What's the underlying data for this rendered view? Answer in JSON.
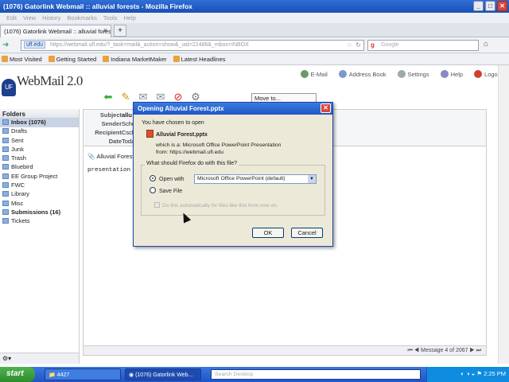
{
  "window": {
    "title": "(1076) Gatorlink Webmail :: alluvial forests - Mozilla Firefox"
  },
  "menubar": [
    "Edit",
    "View",
    "History",
    "Bookmarks",
    "Tools",
    "Help"
  ],
  "tab": {
    "label": "(1076) Gatorlink Webmail :: alluvial forests"
  },
  "url": {
    "domain": "ufl.edu",
    "path": "https://webmail.ufl.edu/?_task=mail&_action=show&_uid=22486&_mbox=INBOX"
  },
  "search": {
    "placeholder": "Google"
  },
  "bookmarks": [
    "Most Visited",
    "Getting Started",
    "Indiana MarketMaker",
    "Latest Headlines"
  ],
  "webmail": {
    "logo": "WebMail 2.0",
    "logo_badge": "UF",
    "links": [
      "E-Mail",
      "Address Book",
      "Settings",
      "Help",
      "Logout"
    ],
    "moveto": "Move to..."
  },
  "folders": {
    "title": "Folders",
    "items": [
      {
        "label": "Inbox (1076)",
        "active": true
      },
      {
        "label": "Drafts"
      },
      {
        "label": "Sent"
      },
      {
        "label": "Junk"
      },
      {
        "label": "Trash"
      },
      {
        "label": "Bluebird"
      },
      {
        "label": "EE Group Project"
      },
      {
        "label": "FWC"
      },
      {
        "label": "Library"
      },
      {
        "label": "Misc"
      },
      {
        "label": "Submissions (16)",
        "bold": true
      },
      {
        "label": "Tickets"
      }
    ]
  },
  "message": {
    "labels": {
      "subject": "Subject",
      "sender": "Sender",
      "recipient": "Recipient",
      "date": "Date"
    },
    "values": {
      "subject": "allu",
      "sender": "Scho",
      "recipient": "Csch",
      "date": "Toda"
    },
    "attachment": "Alluvial Forest",
    "body": "presentation",
    "footer": "Message 4 of 2067"
  },
  "dialog": {
    "title": "Opening Alluvial Forest.pptx",
    "intro": "You have chosen to open",
    "filename": "Alluvial Forest.pptx",
    "which_is": "which is a:  Microsoft Office PowerPoint Presentation",
    "from": "from:  https://webmail.ufl.edu",
    "question": "What should Firefox do with this file?",
    "open_with_label": "Open with",
    "open_with_value": "Microsoft Office PowerPoint (default)",
    "save_label": "Save File",
    "auto_label": "Do this automatically for files like this from now on.",
    "ok": "OK",
    "cancel": "Cancel"
  },
  "taskbar": {
    "start": "start",
    "tasks": [
      "4427",
      "(1076) Gatorlink Web..."
    ],
    "search_placeholder": "Search Desktop",
    "time": "2:25 PM"
  },
  "colors": {
    "titlebar": "#1f56c4",
    "taskbar": "#2154c6",
    "dialog_bg": "#ece9d8"
  }
}
